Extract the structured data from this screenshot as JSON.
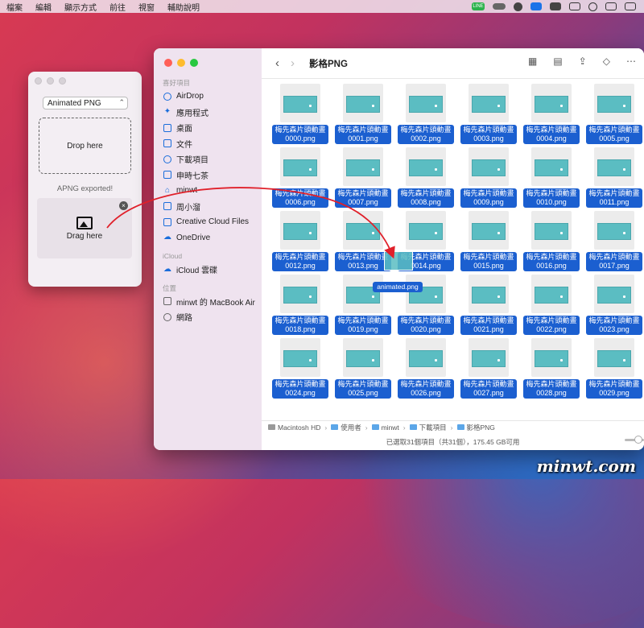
{
  "menubar": {
    "items": [
      "檔案",
      "編輯",
      "顯示方式",
      "前往",
      "視窗",
      "輔助說明"
    ],
    "tray_icons": [
      "line-icon",
      "cloud-icon",
      "theme-icon",
      "clipboard-icon",
      "display-icon",
      "keyboard-icon",
      "time-machine-icon",
      "screen-mirror-icon",
      "wifi-icon"
    ],
    "line_label": "LINE"
  },
  "apng_tool": {
    "format": "Animated PNG",
    "drop_label": "Drop here",
    "status": "APNG exported!",
    "drag_label": "Drag here"
  },
  "finder": {
    "folder_title": "影格PNG",
    "sidebar": {
      "sections": [
        {
          "title": "喜好項目",
          "items": [
            {
              "label": "AirDrop",
              "icon": "airdrop-icon"
            },
            {
              "label": "應用程式",
              "icon": "applications-icon"
            },
            {
              "label": "桌面",
              "icon": "desktop-icon"
            },
            {
              "label": "文件",
              "icon": "document-icon"
            },
            {
              "label": "下載項目",
              "icon": "downloads-icon"
            },
            {
              "label": "申時七茶",
              "icon": "folder-icon"
            },
            {
              "label": "minwt",
              "icon": "home-icon"
            },
            {
              "label": "周小溜",
              "icon": "folder-icon"
            },
            {
              "label": "Creative Cloud Files",
              "icon": "folder-icon"
            },
            {
              "label": "OneDrive",
              "icon": "cloud-icon"
            }
          ]
        },
        {
          "title": "iCloud",
          "items": [
            {
              "label": "iCloud 雲碟",
              "icon": "icloud-icon"
            }
          ]
        },
        {
          "title": "位置",
          "items": [
            {
              "label": "minwt 的 MacBook Air",
              "icon": "laptop-icon"
            },
            {
              "label": "網路",
              "icon": "network-icon"
            }
          ]
        }
      ]
    },
    "files": [
      "梅先森片頭動畫0000.png",
      "梅先森片頭動畫0001.png",
      "梅先森片頭動畫0002.png",
      "梅先森片頭動畫0003.png",
      "梅先森片頭動畫0004.png",
      "梅先森片頭動畫0005.png",
      "梅先森片頭動畫0006.png",
      "梅先森片頭動畫0007.png",
      "梅先森片頭動畫0008.png",
      "梅先森片頭動畫0009.png",
      "梅先森片頭動畫0010.png",
      "梅先森片頭動畫0011.png",
      "梅先森片頭動畫0012.png",
      "梅先森片頭動畫0013.png",
      "梅先森片頭動畫0014.png",
      "梅先森片頭動畫0015.png",
      "梅先森片頭動畫0016.png",
      "梅先森片頭動畫0017.png",
      "梅先森片頭動畫0018.png",
      "梅先森片頭動畫0019.png",
      "梅先森片頭動畫0020.png",
      "梅先森片頭動畫0021.png",
      "梅先森片頭動畫0022.png",
      "梅先森片頭動畫0023.png",
      "梅先森片頭動畫0024.png",
      "梅先森片頭動畫0025.png",
      "梅先森片頭動畫0026.png",
      "梅先森片頭動畫0027.png",
      "梅先森片頭動畫0028.png",
      "梅先森片頭動畫0029.png"
    ],
    "dragged_file": "animated.png",
    "path": [
      "Macintosh HD",
      "使用者",
      "minwt",
      "下載項目",
      "影格PNG"
    ],
    "status": "已選取31個項目（共31個），175.45 GB可用"
  },
  "watermark": "minwt.com",
  "colors": {
    "selection": "#1b5fd0",
    "thumb_fill": "#5bbdc2",
    "sidebar_accent": "#1a6ddb"
  }
}
